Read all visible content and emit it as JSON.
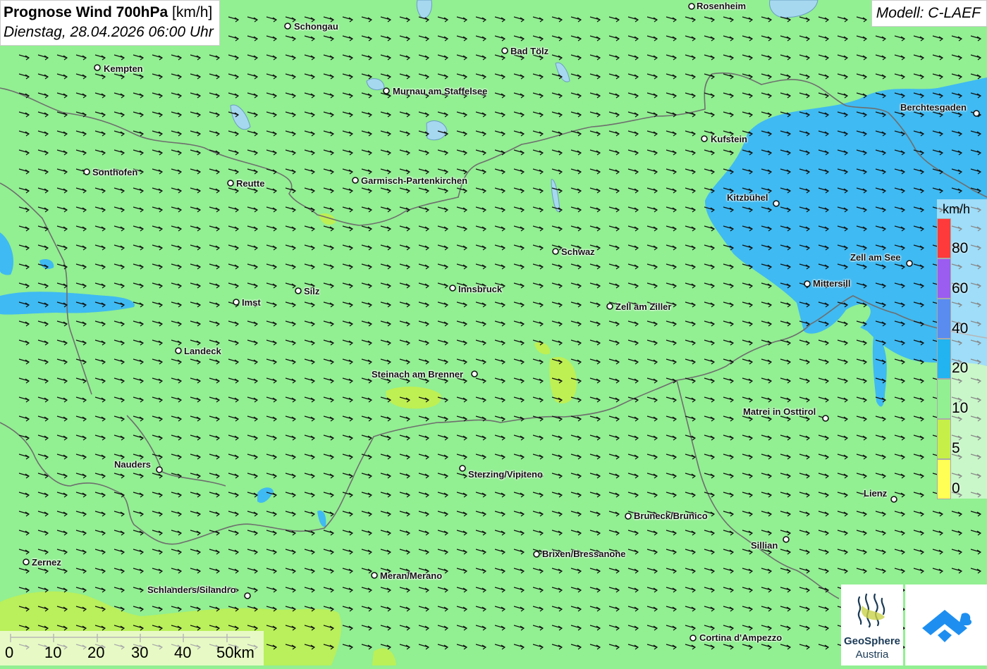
{
  "title": {
    "main": "Prognose Wind 700hPa",
    "unit": "[km/h]",
    "datetime": "Dienstag, 28.04.2026 06:00 Uhr"
  },
  "model": "Modell: C-LAEF",
  "legend": {
    "unit": "km/h",
    "labels": [
      "80",
      "60",
      "40",
      "20",
      "10",
      "5",
      "0"
    ],
    "colors": [
      "#ff3a3a",
      "#9b5cf0",
      "#5a8cf0",
      "#22b4f0",
      "#92ef92",
      "#c6f048",
      "#ffff55"
    ]
  },
  "scale": {
    "labels": [
      "0",
      "10",
      "20",
      "30",
      "40",
      "50km"
    ]
  },
  "cities": [
    {
      "name": "Rosenheim"
    },
    {
      "name": "Schongau"
    },
    {
      "name": "Bad Tölz"
    },
    {
      "name": "Kempten"
    },
    {
      "name": "Murnau am Staffelsee"
    },
    {
      "name": "Berchtesgaden"
    },
    {
      "name": "Kufstein"
    },
    {
      "name": "Sonthofen"
    },
    {
      "name": "Reutte"
    },
    {
      "name": "Garmisch-Partenkirchen"
    },
    {
      "name": "Kitzbühel"
    },
    {
      "name": "Schwaz"
    },
    {
      "name": "Zell am See"
    },
    {
      "name": "Innsbruck"
    },
    {
      "name": "Silz"
    },
    {
      "name": "Mittersill"
    },
    {
      "name": "Imst"
    },
    {
      "name": "Zell am Ziller"
    },
    {
      "name": "Landeck"
    },
    {
      "name": "Steinach am Brenner"
    },
    {
      "name": "Matrei in Osttirol"
    },
    {
      "name": "Nauders"
    },
    {
      "name": "Sterzing/Vipiteno"
    },
    {
      "name": "Lienz"
    },
    {
      "name": "Bruneck/Brunico"
    },
    {
      "name": "Sillian"
    },
    {
      "name": "Brixen/Bressanone"
    },
    {
      "name": "Zernez"
    },
    {
      "name": "Meran/Merano"
    },
    {
      "name": "Schlanders/Silandro"
    },
    {
      "name": "Cortina d'Ampezzo"
    }
  ],
  "logos": {
    "geosphere_name": "GeoSphere",
    "geosphere_sub": "Austria"
  },
  "colors": {
    "wind_10_20": "#92ef92",
    "wind_20_40": "#22b4f0",
    "wind_5_10": "#c6f048",
    "border": "#707070",
    "arrow": "#111111"
  }
}
